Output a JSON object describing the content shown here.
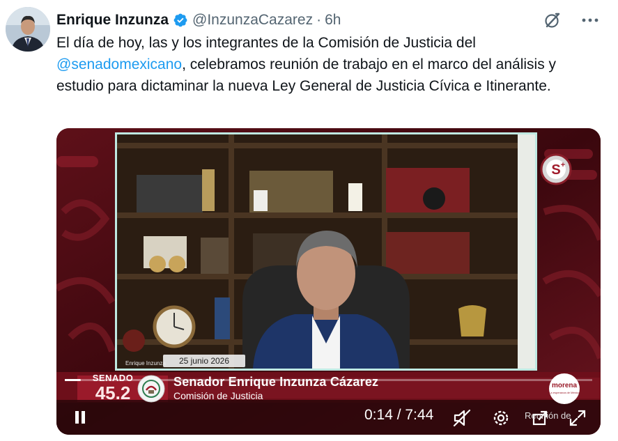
{
  "author": {
    "name": "Enrique Inzunza",
    "handle": "@InzunzaCazarez",
    "separator": "·",
    "time": "6h"
  },
  "tweet": {
    "text_part1": "El día de hoy, las y los integrantes de la Comisión de Justicia del",
    "mention": "@senadomexicano",
    "text_part2": ", celebramos reunión de trabajo en el marco del análisis y estudio para dictaminar la nueva Ley General de Justicia Cívica e Itinerante."
  },
  "video": {
    "cam_caption": "Enrique Inzunza",
    "date": "25 junio 2026",
    "senado_word": "SENADO",
    "senado_number": "45.2",
    "lower_third_name": "Senador Enrique Inzunza Cázarez",
    "lower_third_sub": "Comisión de Justicia",
    "morena_logo": "morena",
    "morena_tagline": "La esperanza de México",
    "timecode": "0:14 / 7:44",
    "overlay_text": "Reunión de",
    "progress": 0.03
  },
  "icons": {
    "verified": "verified-badge-icon",
    "grok": "grok-icon",
    "more": "more-icon",
    "pause": "pause-icon",
    "mute": "mute-icon",
    "settings": "settings-icon",
    "share": "share-icon",
    "fullscreen": "fullscreen-icon"
  },
  "colors": {
    "link": "#1d9bf0",
    "verified": "#1d9bf0",
    "secondary_text": "#536471",
    "senado_red": "#7d1522"
  }
}
